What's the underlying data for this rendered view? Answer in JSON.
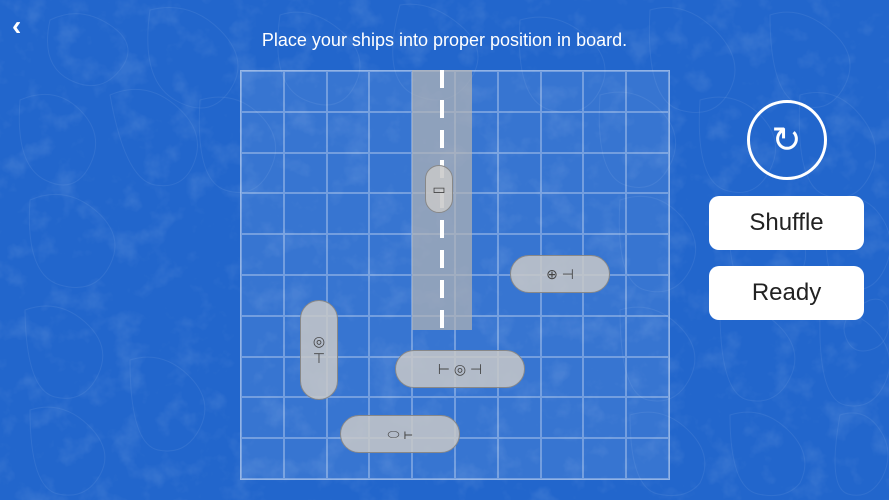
{
  "instruction": "Place your ships into proper position in board.",
  "back_label": "‹",
  "rotate_icon": "↻",
  "shuffle_label": "Shuffle",
  "ready_label": "Ready",
  "ships": [
    {
      "id": 1,
      "type": "small-vertical"
    },
    {
      "id": 2,
      "type": "medium-horizontal-right"
    },
    {
      "id": 3,
      "type": "medium-vertical-left"
    },
    {
      "id": 4,
      "type": "large-horizontal-center"
    },
    {
      "id": 5,
      "type": "medium-horizontal-bottom"
    }
  ],
  "board": {
    "cols": 10,
    "rows": 10
  }
}
